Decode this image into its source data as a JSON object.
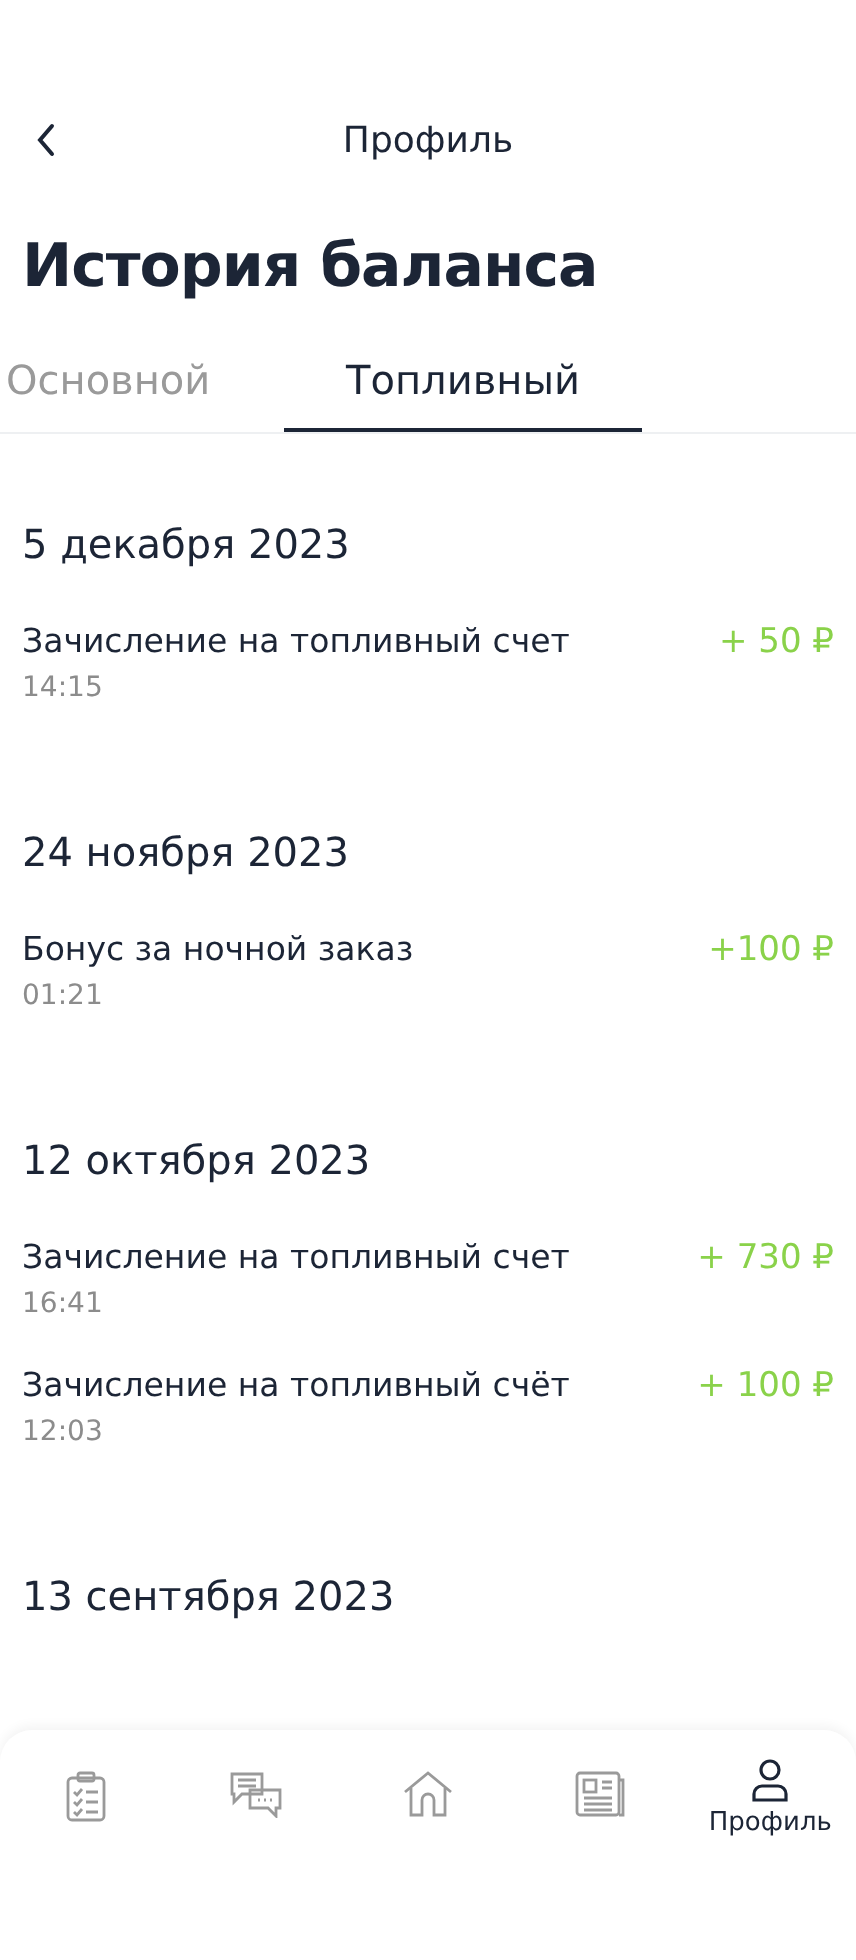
{
  "header": {
    "title": "Профиль"
  },
  "page_title": "История баланса",
  "tabs": [
    {
      "label": "Основной",
      "selected": false
    },
    {
      "label": "Топливный",
      "selected": true
    }
  ],
  "groups": [
    {
      "date": "5 декабря 2023",
      "entries": [
        {
          "title": "Зачисление на топливный счет",
          "time": "14:15",
          "amount": "+ 50 ₽"
        }
      ]
    },
    {
      "date": "24 ноября 2023",
      "entries": [
        {
          "title": "Бонус за ночной заказ",
          "time": "01:21",
          "amount": "+100 ₽"
        }
      ]
    },
    {
      "date": "12 октября 2023",
      "entries": [
        {
          "title": "Зачисление на топливный счет",
          "time": "16:41",
          "amount": "+ 730 ₽"
        },
        {
          "title": "Зачисление на топливный счёт",
          "time": "12:03",
          "amount": "+ 100 ₽"
        }
      ]
    },
    {
      "date": "13 сентября 2023"
    }
  ],
  "bottom_nav": [
    {
      "kind": "tasks",
      "selected": false
    },
    {
      "kind": "chat",
      "selected": false
    },
    {
      "kind": "home",
      "selected": false
    },
    {
      "kind": "news",
      "selected": false
    },
    {
      "kind": "profile",
      "selected": true,
      "label": "Профиль"
    }
  ]
}
